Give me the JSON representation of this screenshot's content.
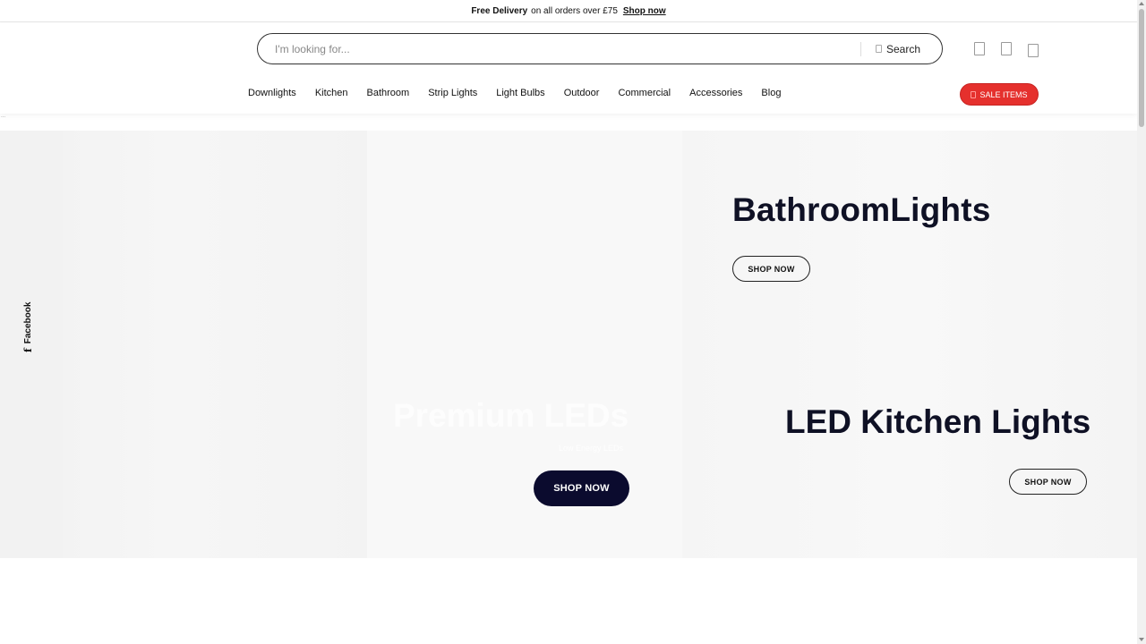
{
  "announcement": {
    "bold_text": "Free Delivery",
    "text": "on all orders over £75",
    "link_label": "Shop now"
  },
  "search": {
    "placeholder": "I'm looking for...",
    "button_label": "Search"
  },
  "header_icons": [
    "account-icon",
    "wishlist-icon",
    "cart-icon"
  ],
  "nav": {
    "items": [
      "Downlights",
      "Kitchen",
      "Bathroom",
      "Strip Lights",
      "Light Bulbs",
      "Outdoor",
      "Commercial",
      "Accessories",
      "Blog"
    ],
    "sale_label": "SALE ITEMS"
  },
  "social": {
    "label": "Facebook",
    "icon_glyph": "f"
  },
  "hero": {
    "bathroom": {
      "title": "BathroomLights",
      "cta": "SHOP NOW"
    },
    "kitchen": {
      "title": "LED Kitchen Lights",
      "cta": "SHOP NOW"
    },
    "premium": {
      "title": "Premium LEDs",
      "subtitle": "Low Energy LEDs",
      "cta": "SHOP NOW"
    }
  },
  "colors": {
    "accent_sale": "#e5302d",
    "dark_button": "#0b0b2e",
    "heading": "#0f1125"
  }
}
